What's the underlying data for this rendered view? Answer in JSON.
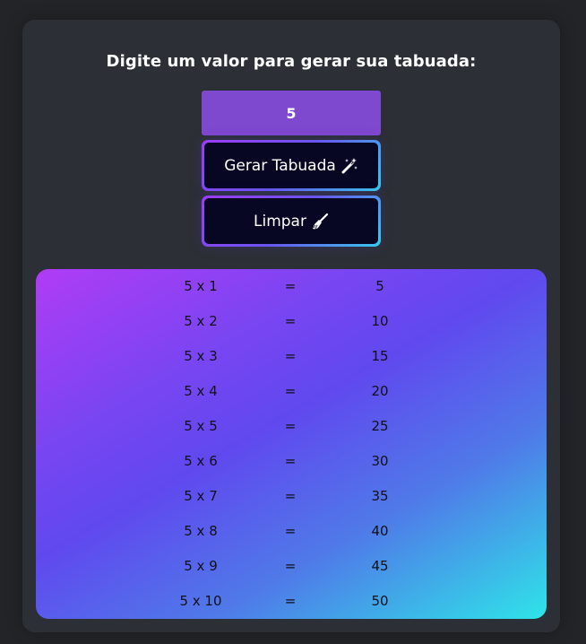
{
  "title": "Digite um valor para gerar sua tabuada:",
  "input": {
    "value": "5"
  },
  "buttons": {
    "generate_label": "Gerar Tabuada",
    "clear_label": "Limpar"
  },
  "icons": {
    "generate": "magic-wand-icon",
    "clear": "broom-icon"
  },
  "colors": {
    "input_bg": "#7e48cf",
    "button_bg": "#070724",
    "gradient": [
      "#b03cf5",
      "#6048ef",
      "#2fe4e8"
    ]
  },
  "table": {
    "rows": [
      {
        "expr": "5 x 1",
        "eq": "=",
        "result": "5"
      },
      {
        "expr": "5 x 2",
        "eq": "=",
        "result": "10"
      },
      {
        "expr": "5 x 3",
        "eq": "=",
        "result": "15"
      },
      {
        "expr": "5 x 4",
        "eq": "=",
        "result": "20"
      },
      {
        "expr": "5 x 5",
        "eq": "=",
        "result": "25"
      },
      {
        "expr": "5 x 6",
        "eq": "=",
        "result": "30"
      },
      {
        "expr": "5 x 7",
        "eq": "=",
        "result": "35"
      },
      {
        "expr": "5 x 8",
        "eq": "=",
        "result": "40"
      },
      {
        "expr": "5 x 9",
        "eq": "=",
        "result": "45"
      },
      {
        "expr": "5 x 10",
        "eq": "=",
        "result": "50"
      }
    ]
  }
}
